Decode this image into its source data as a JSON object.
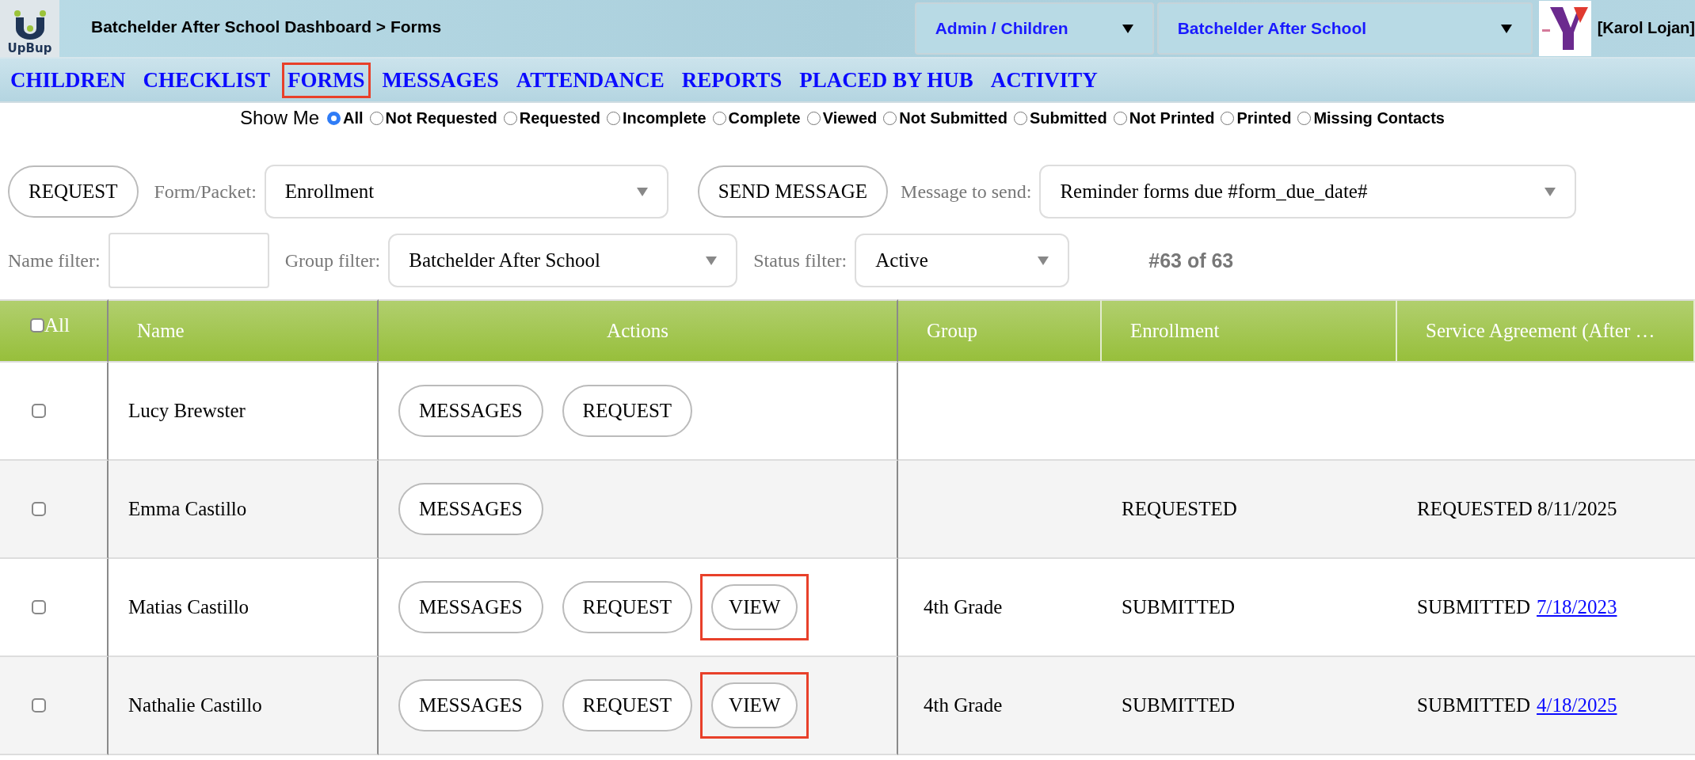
{
  "header": {
    "logo_text": "UpBup",
    "breadcrumb": "Batchelder After School Dashboard > Forms",
    "role_select": "Admin / Children",
    "site_select": "Batchelder After School",
    "user": "[Karol Lojan]"
  },
  "nav": [
    {
      "label": "CHILDREN",
      "highlighted": false
    },
    {
      "label": "CHECKLIST",
      "highlighted": false
    },
    {
      "label": "FORMS",
      "highlighted": true
    },
    {
      "label": "MESSAGES",
      "highlighted": false
    },
    {
      "label": "ATTENDANCE",
      "highlighted": false
    },
    {
      "label": "REPORTS",
      "highlighted": false
    },
    {
      "label": "PLACED BY HUB",
      "highlighted": false
    },
    {
      "label": "ACTIVITY",
      "highlighted": false
    }
  ],
  "show_me": {
    "label": "Show Me",
    "options": [
      {
        "label": "All",
        "selected": true
      },
      {
        "label": "Not Requested",
        "selected": false
      },
      {
        "label": "Requested",
        "selected": false
      },
      {
        "label": "Incomplete",
        "selected": false
      },
      {
        "label": "Complete",
        "selected": false
      },
      {
        "label": "Viewed",
        "selected": false
      },
      {
        "label": "Not Submitted",
        "selected": false
      },
      {
        "label": "Submitted",
        "selected": false
      },
      {
        "label": "Not Printed",
        "selected": false
      },
      {
        "label": "Printed",
        "selected": false
      },
      {
        "label": "Missing Contacts",
        "selected": false
      }
    ]
  },
  "request_button": "REQUEST",
  "form_label": "Form/Packet:",
  "form_value": "Enrollment",
  "send_button": "SEND MESSAGE",
  "message_label": "Message to send:",
  "message_value": "Reminder forms due #form_due_date#",
  "name_filter_label": "Name filter:",
  "group_filter_label": "Group filter:",
  "group_filter_value": "Batchelder After School",
  "status_filter_label": "Status filter:",
  "status_filter_value": "Active",
  "count": "#63 of 63",
  "table": {
    "select_all": {
      "label": "All",
      "checked": false
    },
    "columns": [
      "Name",
      "Actions",
      "Group",
      "Enrollment",
      "Service Agreement (After …"
    ],
    "rows": [
      {
        "checked": false,
        "name": "Lucy Brewster",
        "actions": [
          {
            "label": "MESSAGES",
            "highlighted": false
          },
          {
            "label": "REQUEST",
            "highlighted": false
          }
        ],
        "service": {}
      },
      {
        "checked": false,
        "name": "Emma Castillo",
        "actions": [
          {
            "label": "MESSAGES",
            "highlighted": false
          }
        ],
        "enrollment": "REQUESTED",
        "service": {
          "text": "REQUESTED 8/11/2025"
        }
      },
      {
        "checked": false,
        "name": "Matias Castillo",
        "actions": [
          {
            "label": "MESSAGES",
            "highlighted": false
          },
          {
            "label": "REQUEST",
            "highlighted": false
          },
          {
            "label": "VIEW",
            "highlighted": true
          }
        ],
        "group": "4th Grade",
        "enrollment": "SUBMITTED",
        "service": {
          "text": "SUBMITTED",
          "link": "7/18/2023"
        }
      },
      {
        "checked": false,
        "name": "Nathalie Castillo",
        "actions": [
          {
            "label": "MESSAGES",
            "highlighted": false
          },
          {
            "label": "REQUEST",
            "highlighted": false
          },
          {
            "label": "VIEW",
            "highlighted": true
          }
        ],
        "group": "4th Grade",
        "enrollment": "SUBMITTED",
        "service": {
          "text": "SUBMITTED",
          "link": "4/18/2025"
        }
      }
    ]
  }
}
